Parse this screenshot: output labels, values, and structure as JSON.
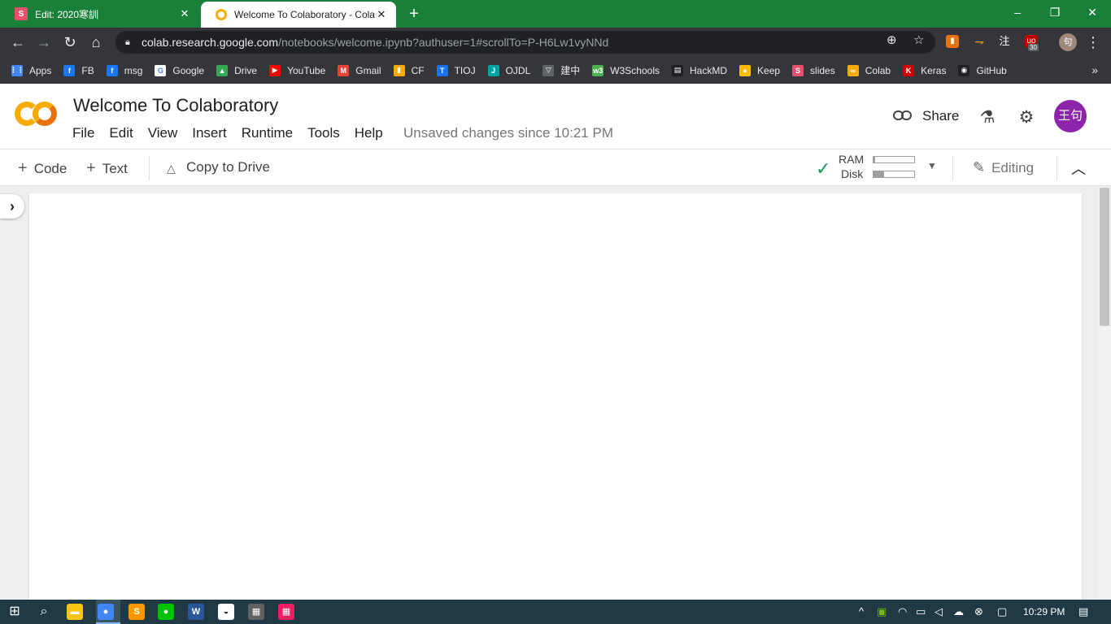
{
  "browser": {
    "tabs": [
      {
        "title": "Edit: 2020寒訓",
        "favicon": "slides-icon",
        "active": false
      },
      {
        "title": "Welcome To Colaboratory - Colab",
        "favicon": "colab-icon",
        "active": true
      }
    ],
    "new_tab_label": "+",
    "window_controls": {
      "minimize": "–",
      "restore": "❐",
      "close": "✕"
    },
    "url": {
      "host": "colab.research.google.com",
      "path": "/notebooks/welcome.ipynb?authuser=1#scrollTo=P-H6Lw1vyNNd"
    },
    "extension_badge": "30",
    "extension_label_zhu": "注",
    "profile_label": "句",
    "bookmarks": [
      {
        "label": "Apps",
        "icon": "apps-grid-icon",
        "color": "#4285f4",
        "glyph": "⋮⋮"
      },
      {
        "label": "FB",
        "icon": "facebook-icon",
        "color": "#1877f2",
        "glyph": "f"
      },
      {
        "label": "msg",
        "icon": "facebook-icon",
        "color": "#1877f2",
        "glyph": "f"
      },
      {
        "label": "Google",
        "icon": "google-icon",
        "color": "#ffffff",
        "glyph": "G"
      },
      {
        "label": "Drive",
        "icon": "drive-icon",
        "color": "#34a853",
        "glyph": "▲"
      },
      {
        "label": "YouTube",
        "icon": "youtube-icon",
        "color": "#ff0000",
        "glyph": "▶"
      },
      {
        "label": "Gmail",
        "icon": "gmail-icon",
        "color": "#ea4335",
        "glyph": "M"
      },
      {
        "label": "CF",
        "icon": "codeforces-icon",
        "color": "#f9ab00",
        "glyph": "▮"
      },
      {
        "label": "TIOJ",
        "icon": "tioj-icon",
        "color": "#1a73e8",
        "glyph": "T"
      },
      {
        "label": "OJDL",
        "icon": "ojdl-icon",
        "color": "#00a3a3",
        "glyph": "J"
      },
      {
        "label": "建中",
        "icon": "school-icon",
        "color": "#5f6368",
        "glyph": "▽"
      },
      {
        "label": "W3Schools",
        "icon": "w3schools-icon",
        "color": "#4caf50",
        "glyph": "w3"
      },
      {
        "label": "HackMD",
        "icon": "hackmd-icon",
        "color": "#202124",
        "glyph": "▤"
      },
      {
        "label": "Keep",
        "icon": "keep-icon",
        "color": "#fbbc04",
        "glyph": "●"
      },
      {
        "label": "slides",
        "icon": "slides-icon",
        "color": "#e7506d",
        "glyph": "S"
      },
      {
        "label": "Colab",
        "icon": "colab-icon",
        "color": "#f9ab00",
        "glyph": "∞"
      },
      {
        "label": "Keras",
        "icon": "keras-icon",
        "color": "#d00000",
        "glyph": "K"
      },
      {
        "label": "GitHub",
        "icon": "github-icon",
        "color": "#202124",
        "glyph": "◉"
      }
    ],
    "bookmarks_more": "»"
  },
  "colab": {
    "title": "Welcome To Colaboratory",
    "menu": [
      "File",
      "Edit",
      "View",
      "Insert",
      "Runtime",
      "Tools",
      "Help"
    ],
    "unsaved_status": "Unsaved changes since 10:21 PM",
    "share_label": "Share",
    "avatar_text": "王句",
    "avatar_color": "#8e24aa",
    "toolbar": {
      "code_label": "Code",
      "text_label": "Text",
      "copy_to_drive_label": "Copy to Drive",
      "ram_label": "RAM",
      "disk_label": "Disk",
      "ram_usage": 0.04,
      "disk_usage": 0.25,
      "editing_label": "Editing"
    },
    "brand_colors": {
      "logo_yellow": "#f9ab00",
      "logo_orange": "#e8710a",
      "connected_green": "#0f9d58"
    }
  },
  "taskbar": {
    "clock": "10:29 PM",
    "apps": [
      {
        "icon": "file-explorer-icon",
        "color": "#f9c513",
        "glyph": "▬"
      },
      {
        "icon": "chrome-icon",
        "color": "#4285f4",
        "glyph": "●"
      },
      {
        "icon": "sublime-text-icon",
        "color": "#ff9800",
        "glyph": "S"
      },
      {
        "icon": "line-icon",
        "color": "#00c300",
        "glyph": "●"
      },
      {
        "icon": "word-icon",
        "color": "#2b579a",
        "glyph": "W"
      },
      {
        "icon": "onedrive-photos-icon",
        "color": "#ffffff",
        "glyph": "◒"
      },
      {
        "icon": "calculator-icon",
        "color": "#616161",
        "glyph": "▦"
      },
      {
        "icon": "app-grid-icon",
        "color": "#e91e63",
        "glyph": "▦"
      }
    ]
  }
}
